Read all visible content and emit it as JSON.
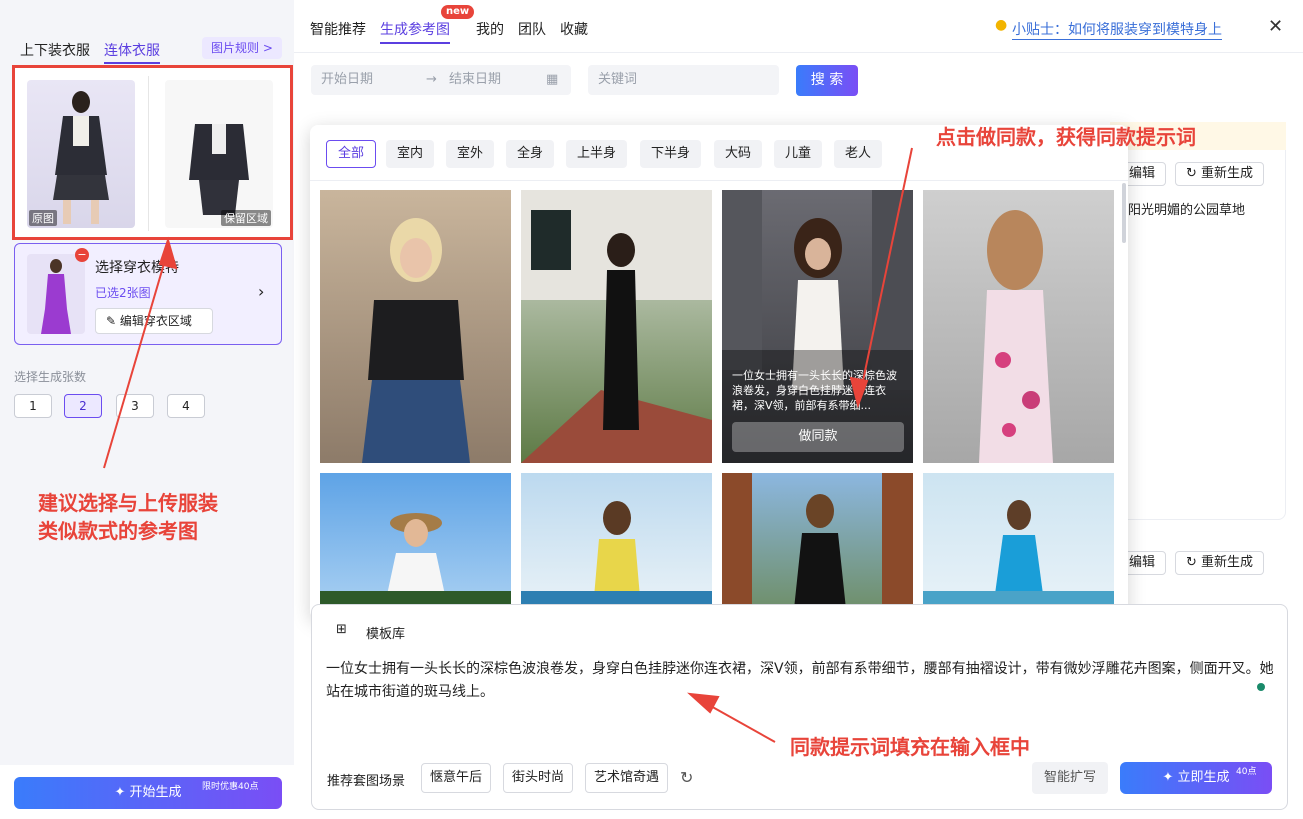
{
  "left": {
    "tabs": [
      "上下装衣服",
      "连体衣服"
    ],
    "rule_button": "图片规则",
    "orig_label": "原图",
    "keep_label": "保留区域",
    "model_title": "选择穿衣模特",
    "model_selected": "已选2张图",
    "edit_area": "编辑穿衣区域",
    "count_label": "选择生成张数",
    "counts": [
      "1",
      "2",
      "3",
      "4"
    ],
    "start_button": "开始生成",
    "start_badge": "限时优惠40点"
  },
  "nav": {
    "tabs": [
      "智能推荐",
      "生成参考图",
      "我的",
      "团队",
      "收藏"
    ],
    "new_badge": "new",
    "tip": "小贴士：如何将服装穿到模特身上"
  },
  "filters": {
    "start_date": "开始日期",
    "end_date": "结束日期",
    "keyword": "关键词",
    "search": "搜 索"
  },
  "bg": {
    "edit": "编辑",
    "regen": "重新生成",
    "snippet": "阳光明媚的公园草地"
  },
  "popup": {
    "chips": [
      "全部",
      "室内",
      "室外",
      "全身",
      "上半身",
      "下半身",
      "大码",
      "儿童",
      "老人"
    ],
    "hover_text": "一位女士拥有一头长长的深棕色波浪卷发，身穿白色挂脖迷你连衣裙，深V领，前部有系带细...",
    "same_button": "做同款"
  },
  "input": {
    "template": "模板库",
    "prompt": "一位女士拥有一头长长的深棕色波浪卷发，身穿白色挂脖迷你连衣裙，深V领，前部有系带细节，腰部有抽褶设计，带有微妙浮雕花卉图案，侧面开叉。她站在城市街道的斑马线上。",
    "scene_label": "推荐套图场景",
    "scenes": [
      "惬意午后",
      "街头时尚",
      "艺术馆奇遇"
    ],
    "expand": "智能扩写",
    "generate": "立即生成",
    "generate_badge": "40点"
  },
  "annotations": {
    "left_note_1": "建议选择与上传服装",
    "left_note_2": "类似款式的参考图",
    "top_note": "点击做同款，获得同款提示词",
    "bottom_note": "同款提示词填充在输入框中"
  },
  "colors": {
    "accent": "#5b3fe0",
    "annotation": "#e8443a"
  }
}
